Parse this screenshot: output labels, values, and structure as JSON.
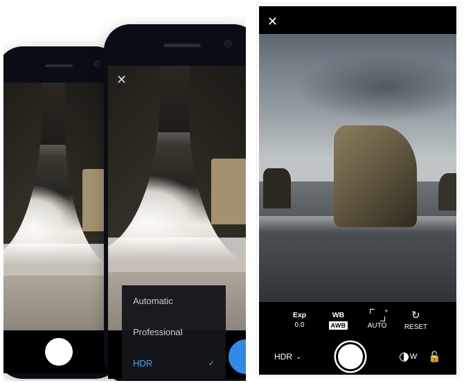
{
  "left": {
    "close_char": "✕",
    "menu": {
      "items": [
        {
          "label": "Automatic",
          "selected": false
        },
        {
          "label": "Professional",
          "selected": false
        },
        {
          "label": "HDR",
          "selected": true
        }
      ],
      "check_char": "✓"
    }
  },
  "right": {
    "close_char": "✕",
    "controls": {
      "exp": {
        "label": "Exp",
        "value": "0.0"
      },
      "wb": {
        "label": "WB",
        "value": "AWB"
      },
      "crop": {
        "label": "AUTO",
        "plus": "+"
      },
      "reset": {
        "label": "RESET",
        "glyph": "↺"
      }
    },
    "bottom": {
      "mode": "HDR",
      "chevron": "⌄",
      "lens_label": "W",
      "lock_glyph": "🔓"
    }
  }
}
